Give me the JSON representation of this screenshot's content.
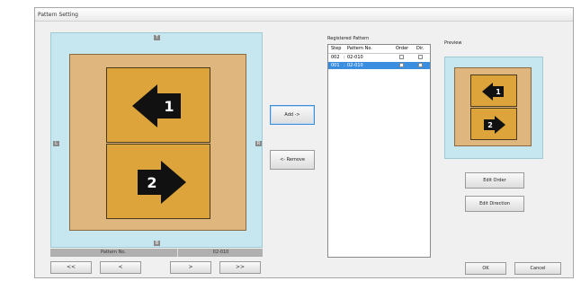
{
  "window": {
    "title": "Pattern Setting"
  },
  "canvas": {
    "edge_top": "T",
    "edge_left": "L",
    "edge_right": "R",
    "edge_bottom": "B",
    "block1_number": "1",
    "block2_number": "2"
  },
  "pattern_bar": {
    "label": "Pattern No.",
    "value": "02-010"
  },
  "nav": {
    "first": "<<",
    "prev": "<",
    "next": ">",
    "last": ">>"
  },
  "actions": {
    "add": "Add ->",
    "remove": "<- Remove"
  },
  "registered": {
    "title": "Registered Pattern",
    "columns": [
      "Step",
      "Pattern No.",
      "Order",
      "Dir."
    ],
    "rows": [
      {
        "step": "002",
        "pattern": "02-010",
        "order": false,
        "dir": false,
        "selected": false
      },
      {
        "step": "001",
        "pattern": "02-010",
        "order": false,
        "dir": false,
        "selected": true
      }
    ]
  },
  "preview": {
    "title": "Preview",
    "block1_number": "1",
    "block2_number": "2"
  },
  "buttons": {
    "edit_order": "Edit Order",
    "edit_direction": "Edit Direction",
    "ok": "OK",
    "cancel": "Cancel"
  },
  "colors": {
    "canvas_bg": "#c6e7ef",
    "tan": "#dfb77e",
    "block": "#dca43a",
    "arrow": "#111111",
    "selection": "#3b8de0"
  },
  "icons": {
    "block1": "left-arrow-icon",
    "block2": "right-arrow-icon"
  }
}
